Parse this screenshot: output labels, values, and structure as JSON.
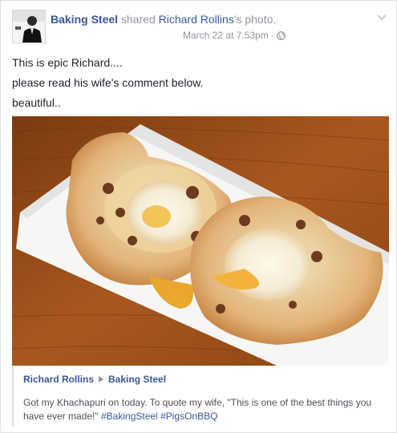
{
  "post": {
    "author": "Baking Steel",
    "action_text": "shared",
    "shared_owner": "Richard Rollins",
    "shared_suffix": "'s photo.",
    "timestamp": "March 22 at 7:53pm",
    "separator": "·",
    "audience_icon": "globe-icon",
    "menu_icon": "chevron-down-icon",
    "text_lines": [
      "This is epic Richard....",
      "please read his wife's comment below.",
      "beautiful.."
    ]
  },
  "photo": {
    "description_icon": "photo-of-khachapuri-pastry-on-white-plate"
  },
  "shared_post": {
    "author": "Richard Rollins",
    "target": "Baking Steel",
    "text": "Got my Khachapuri on today. To quote my wife, \"This is one of the best things you have ever made!\"",
    "hashtags": [
      "#BakingSteel",
      "#PigsOnBBQ"
    ]
  },
  "colors": {
    "link": "#365899",
    "meta": "#90949c",
    "text": "#1d2129",
    "border": "#dddfe2"
  }
}
